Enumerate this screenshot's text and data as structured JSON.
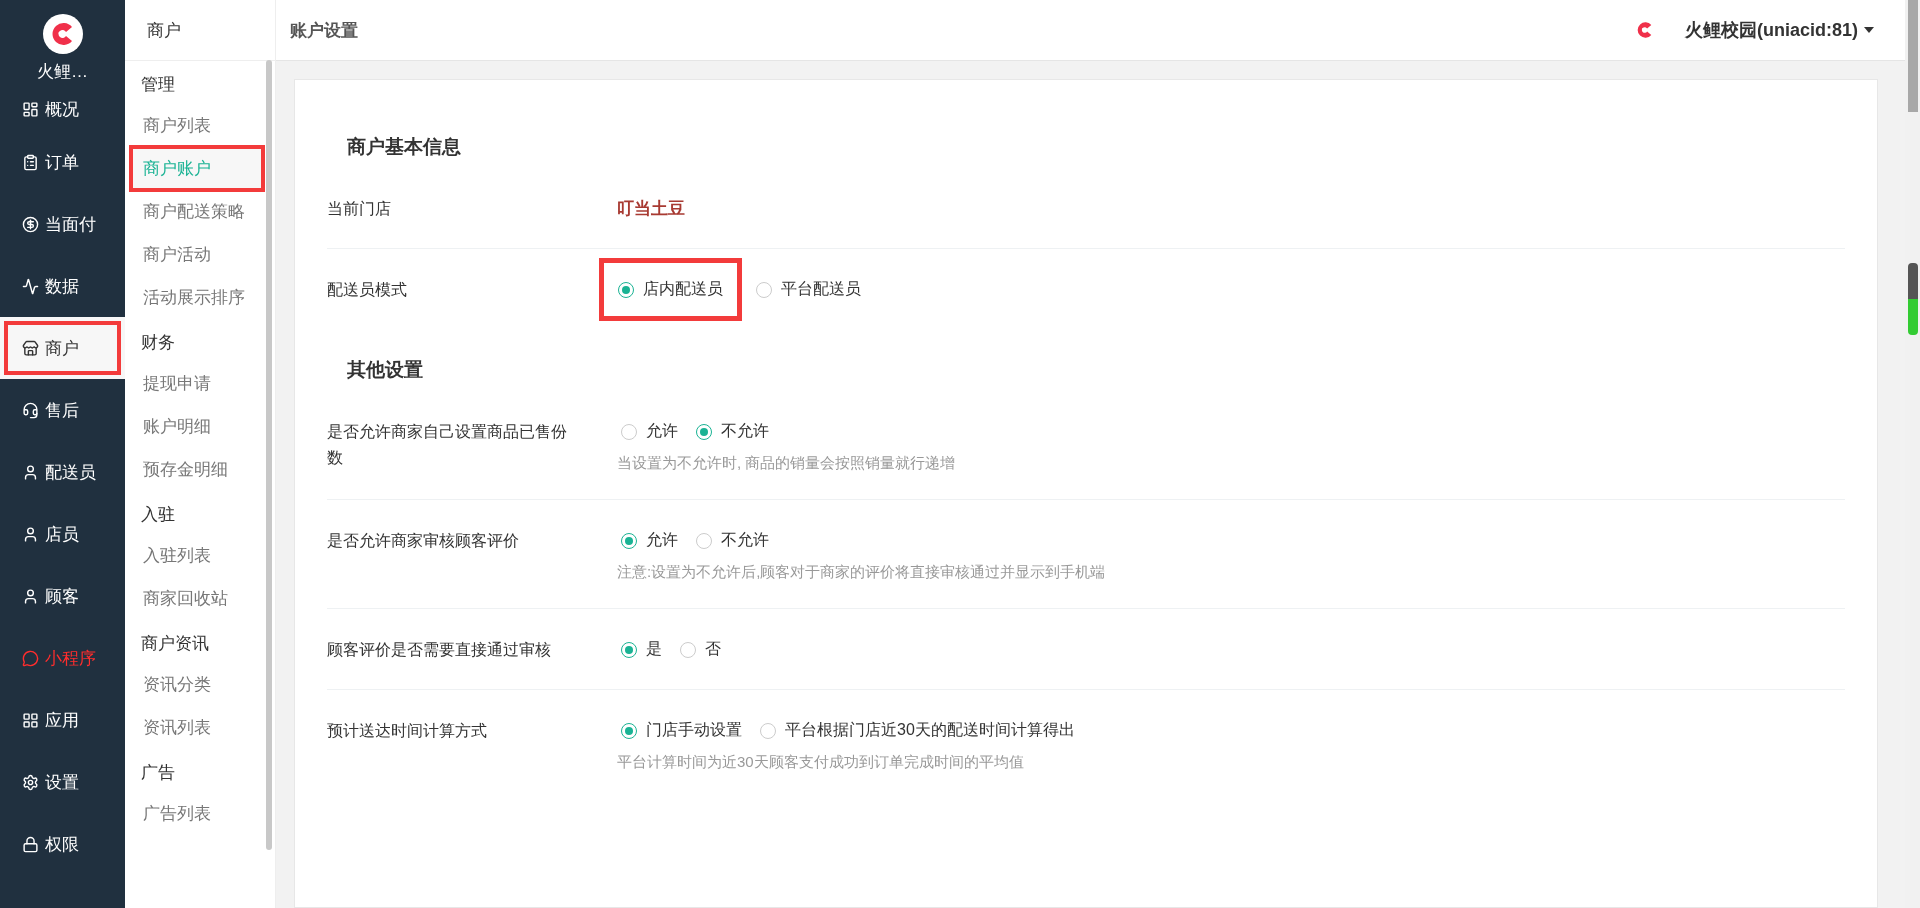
{
  "brand": {
    "name": "火鲤…"
  },
  "main_nav": [
    {
      "label": "概况",
      "selected": false,
      "highlighted": false,
      "kind": "normal"
    },
    {
      "label": "订单",
      "selected": false,
      "highlighted": false,
      "kind": "normal"
    },
    {
      "label": "当面付",
      "selected": false,
      "highlighted": false,
      "kind": "normal"
    },
    {
      "label": "数据",
      "selected": false,
      "highlighted": false,
      "kind": "normal"
    },
    {
      "label": "商户",
      "selected": true,
      "highlighted": true,
      "kind": "normal"
    },
    {
      "label": "售后",
      "selected": false,
      "highlighted": false,
      "kind": "normal"
    },
    {
      "label": "配送员",
      "selected": false,
      "highlighted": false,
      "kind": "normal"
    },
    {
      "label": "店员",
      "selected": false,
      "highlighted": false,
      "kind": "normal"
    },
    {
      "label": "顾客",
      "selected": false,
      "highlighted": false,
      "kind": "normal"
    },
    {
      "label": "小程序",
      "selected": false,
      "highlighted": false,
      "kind": "accent"
    },
    {
      "label": "应用",
      "selected": false,
      "highlighted": false,
      "kind": "normal"
    },
    {
      "label": "设置",
      "selected": false,
      "highlighted": false,
      "kind": "normal"
    },
    {
      "label": "权限",
      "selected": false,
      "highlighted": false,
      "kind": "normal"
    }
  ],
  "sub_nav": {
    "title": "商户",
    "groups": [
      {
        "title": "管理",
        "items": [
          {
            "label": "商户列表",
            "selected": false,
            "highlighted": false
          },
          {
            "label": "商户账户",
            "selected": true,
            "highlighted": true
          },
          {
            "label": "商户配送策略",
            "selected": false,
            "highlighted": false
          },
          {
            "label": "商户活动",
            "selected": false,
            "highlighted": false
          },
          {
            "label": "活动展示排序",
            "selected": false,
            "highlighted": false
          }
        ]
      },
      {
        "title": "财务",
        "items": [
          {
            "label": "提现申请",
            "selected": false,
            "highlighted": false
          },
          {
            "label": "账户明细",
            "selected": false,
            "highlighted": false
          },
          {
            "label": "预存金明细",
            "selected": false,
            "highlighted": false
          }
        ]
      },
      {
        "title": "入驻",
        "items": [
          {
            "label": "入驻列表",
            "selected": false,
            "highlighted": false
          },
          {
            "label": "商家回收站",
            "selected": false,
            "highlighted": false
          }
        ]
      },
      {
        "title": "商户资讯",
        "items": [
          {
            "label": "资讯分类",
            "selected": false,
            "highlighted": false
          },
          {
            "label": "资讯列表",
            "selected": false,
            "highlighted": false
          }
        ]
      },
      {
        "title": "广告",
        "items": [
          {
            "label": "广告列表",
            "selected": false,
            "highlighted": false
          }
        ]
      }
    ]
  },
  "header": {
    "title": "账户设置",
    "account": "火鲤校园(uniacid:81)"
  },
  "sections": [
    {
      "title": "商户基本信息",
      "rows": [
        {
          "kind": "text",
          "label": "当前门店",
          "value": "叮当土豆"
        },
        {
          "kind": "radio",
          "label": "配送员模式",
          "options": [
            {
              "label": "店内配送员",
              "selected": true,
              "highlighted": true
            },
            {
              "label": "平台配送员",
              "selected": false,
              "highlighted": false
            }
          ]
        }
      ]
    },
    {
      "title": "其他设置",
      "rows": [
        {
          "kind": "radio",
          "label": "是否允许商家自己设置商品已售份数",
          "options": [
            {
              "label": "允许",
              "selected": false,
              "highlighted": false
            },
            {
              "label": "不允许",
              "selected": true,
              "highlighted": false
            }
          ],
          "hint": "当设置为不允许时, 商品的销量会按照销量就行递增"
        },
        {
          "kind": "radio",
          "label": "是否允许商家审核顾客评价",
          "options": [
            {
              "label": "允许",
              "selected": true,
              "highlighted": false
            },
            {
              "label": "不允许",
              "selected": false,
              "highlighted": false
            }
          ],
          "hint": "注意:设置为不允许后,顾客对于商家的评价将直接审核通过并显示到手机端"
        },
        {
          "kind": "radio",
          "label": "顾客评价是否需要直接通过审核",
          "options": [
            {
              "label": "是",
              "selected": true,
              "highlighted": false
            },
            {
              "label": "否",
              "selected": false,
              "highlighted": false
            }
          ]
        },
        {
          "kind": "radio",
          "label": "预计送达时间计算方式",
          "options": [
            {
              "label": "门店手动设置",
              "selected": true,
              "highlighted": false
            },
            {
              "label": "平台根据门店近30天的配送时间计算得出",
              "selected": false,
              "highlighted": false
            }
          ],
          "hint": "平台计算时间为近30天顾客支付成功到订单完成时间的平均值"
        }
      ]
    }
  ]
}
